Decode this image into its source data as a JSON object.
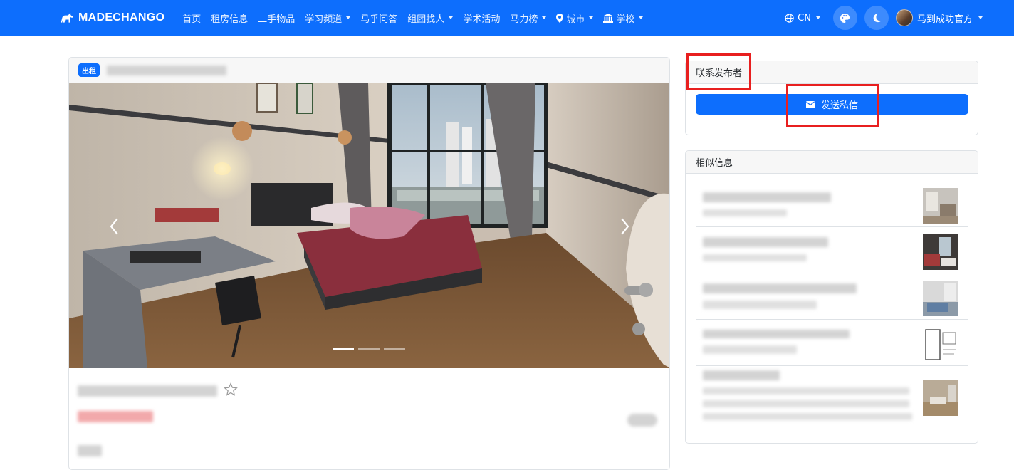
{
  "nav": {
    "brand": "MADECHANGO",
    "links": [
      {
        "label": "首页",
        "dropdown": false
      },
      {
        "label": "租房信息",
        "dropdown": false
      },
      {
        "label": "二手物品",
        "dropdown": false
      },
      {
        "label": "学习频道",
        "dropdown": true
      },
      {
        "label": "马乎问答",
        "dropdown": false
      },
      {
        "label": "组团找人",
        "dropdown": true
      },
      {
        "label": "学术活动",
        "dropdown": false
      },
      {
        "label": "马力榜",
        "dropdown": true
      }
    ],
    "city_label": "城市",
    "school_label": "学校",
    "language": "CN",
    "user_name": "马到成功官方",
    "icons": {
      "brand": "horse-icon",
      "city": "map-pin-icon",
      "school": "bank-icon",
      "language": "globe-icon",
      "theme": "palette-icon",
      "dark_mode": "moon-icon"
    }
  },
  "listing": {
    "badge": "出租",
    "carousel": {
      "slide_count": 3,
      "active_index": 0
    }
  },
  "contact": {
    "header": "联系发布者",
    "button_label": "发送私信",
    "button_icon": "envelope-icon"
  },
  "similar": {
    "header": "相似信息",
    "item_count": 5
  },
  "colors": {
    "primary": "#0d6efd",
    "highlight": "#e81f1f"
  }
}
